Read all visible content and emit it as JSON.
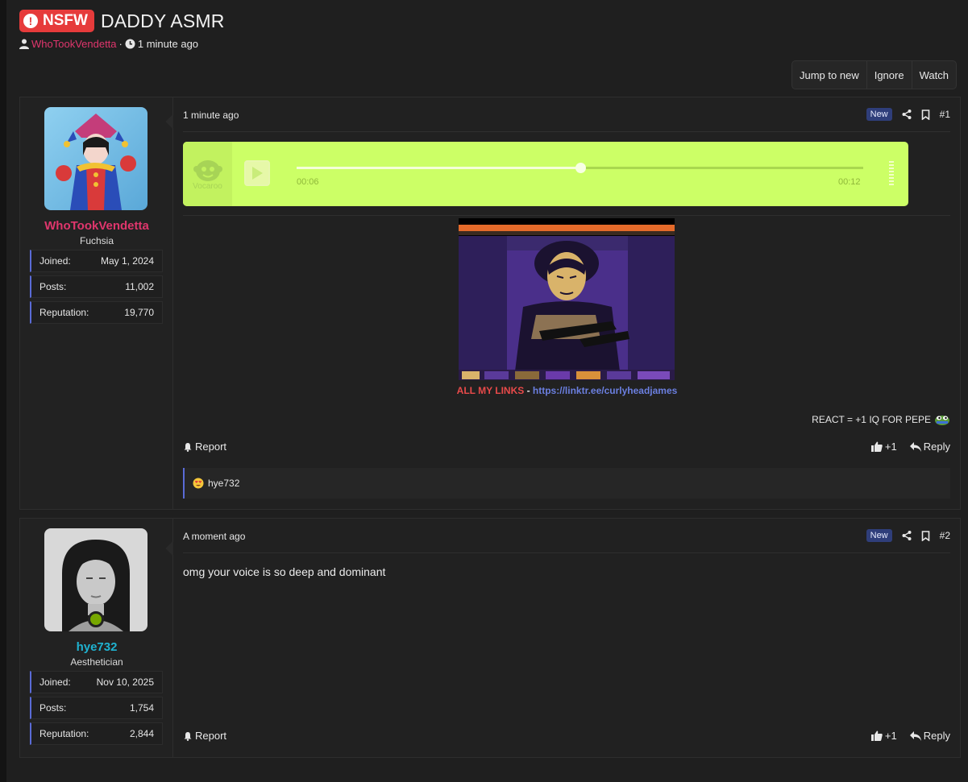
{
  "thread": {
    "prefix": "NSFW",
    "title": "DADDY ASMR",
    "author": "WhoTookVendetta",
    "separator": "·",
    "time": "1 minute ago"
  },
  "actions": {
    "jump_to_new": "Jump to new",
    "ignore": "Ignore",
    "watch": "Watch"
  },
  "posts": [
    {
      "username": "WhoTookVendetta",
      "username_color": "#e0366d",
      "usertitle": "Fuchsia",
      "stats": [
        {
          "label": "Joined:",
          "value": "May 1, 2024"
        },
        {
          "label": "Posts:",
          "value": "11,002"
        },
        {
          "label": "Reputation:",
          "value": "19,770"
        }
      ],
      "date": "1 minute ago",
      "badge": "New",
      "number": "#1",
      "vocaroo": {
        "brand": "Vocaroo",
        "elapsed": "00:06",
        "total": "00:12",
        "progress": 0.5
      },
      "links_label": "ALL MY LINKS",
      "links_sep": " - ",
      "links_url": "https://linktr.ee/curlyheadjames",
      "signature": "REACT = +1 IQ FOR PEPE",
      "report": "Report",
      "like_count": "+1",
      "reply": "Reply",
      "reaction_user": "hye732"
    },
    {
      "username": "hye732",
      "username_color": "#1fb3d1",
      "usertitle": "Aesthetician",
      "stats": [
        {
          "label": "Joined:",
          "value": "Nov 10, 2025"
        },
        {
          "label": "Posts:",
          "value": "1,754"
        },
        {
          "label": "Reputation:",
          "value": "2,844"
        }
      ],
      "date": "A moment ago",
      "badge": "New",
      "number": "#2",
      "body": "omg your voice is so deep and dominant",
      "report": "Report",
      "like_count": "+1",
      "reply": "Reply"
    }
  ],
  "colors": {
    "accent": "#5a6bd6",
    "nsfw": "#e63b3b",
    "vocaroo_bg": "#ccff66"
  }
}
